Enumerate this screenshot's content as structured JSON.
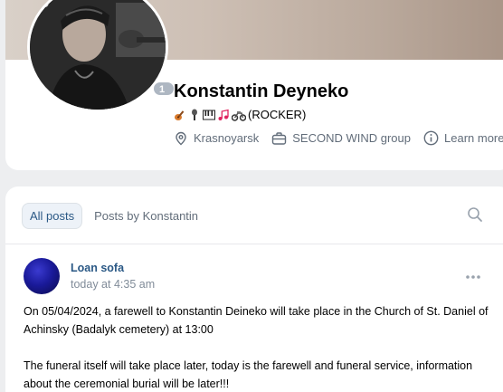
{
  "profile": {
    "name": "Konstantin Deyneko",
    "status_suffix": "(ROCKER)",
    "status_emojis": [
      "guitar-emoji",
      "microphone-emoji",
      "piano-emoji",
      "music-notes-emoji",
      "motorcycle-emoji"
    ],
    "online_badge": "1 m",
    "city": "Krasnoyarsk",
    "work": "SECOND WIND group",
    "learn_more": "Learn more"
  },
  "wall": {
    "tabs": [
      {
        "label": "All posts",
        "active": true
      },
      {
        "label": "Posts by Konstantin",
        "active": false
      }
    ]
  },
  "post": {
    "author": "Loan sofa",
    "time": "today at 4:35 am",
    "paragraphs": [
      "On 05/04/2024, a farewell to Konstantin Deineko will take place in the Church of St. Daniel of Achinsky (Badalyk cemetery) at 13:00",
      "The funeral itself will take place later, today is the farewell and funeral service, information about the ceremonial burial will be later!!!"
    ]
  },
  "colors": {
    "link": "#2a5885",
    "secondary_text": "#626d7a",
    "timestamp": "#818c99",
    "badge": "#aeb7c2",
    "background": "#edeef0"
  }
}
